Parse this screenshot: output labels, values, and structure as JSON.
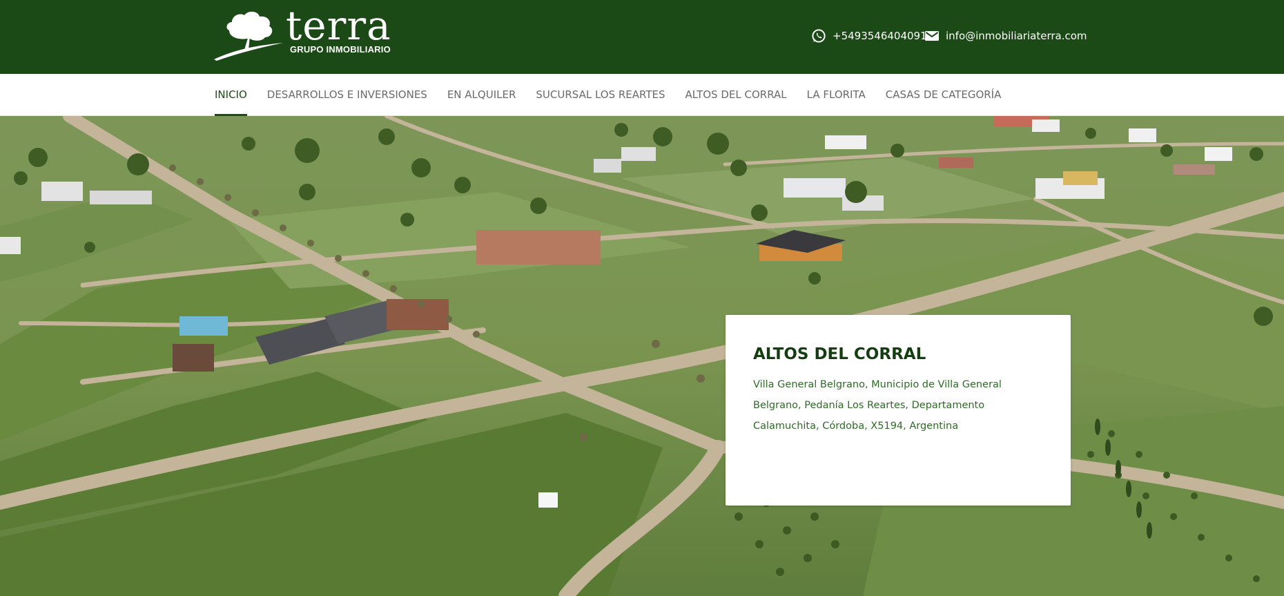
{
  "brand": {
    "name": "terra",
    "tagline": "GRUPO INMOBILIARIO"
  },
  "contact": {
    "phone": "+5493546404091",
    "phone_icon": "whatsapp-icon",
    "email": "info@inmobiliariaterra.com",
    "email_icon": "mail-icon"
  },
  "nav": {
    "items": [
      {
        "label": "INICIO",
        "active": true
      },
      {
        "label": "DESARROLLOS E INVERSIONES",
        "active": false
      },
      {
        "label": "EN ALQUILER",
        "active": false
      },
      {
        "label": "SUCURSAL LOS REARTES",
        "active": false
      },
      {
        "label": "ALTOS DEL CORRAL",
        "active": false
      },
      {
        "label": "LA FLORITA",
        "active": false
      },
      {
        "label": "CASAS DE CATEGORÍA",
        "active": false
      }
    ]
  },
  "hero": {
    "card": {
      "title": "ALTOS DEL CORRAL",
      "address": "Villa General Belgrano, Municipio de Villa General Belgrano, Pedanía Los Reartes, Departamento Calamuchita, Córdoba, X5194, Argentina"
    }
  },
  "colors": {
    "header_bg": "#1c4a16",
    "accent": "#1c4a16",
    "nav_text": "#6a6a6a",
    "card_text": "#2f6a28"
  }
}
